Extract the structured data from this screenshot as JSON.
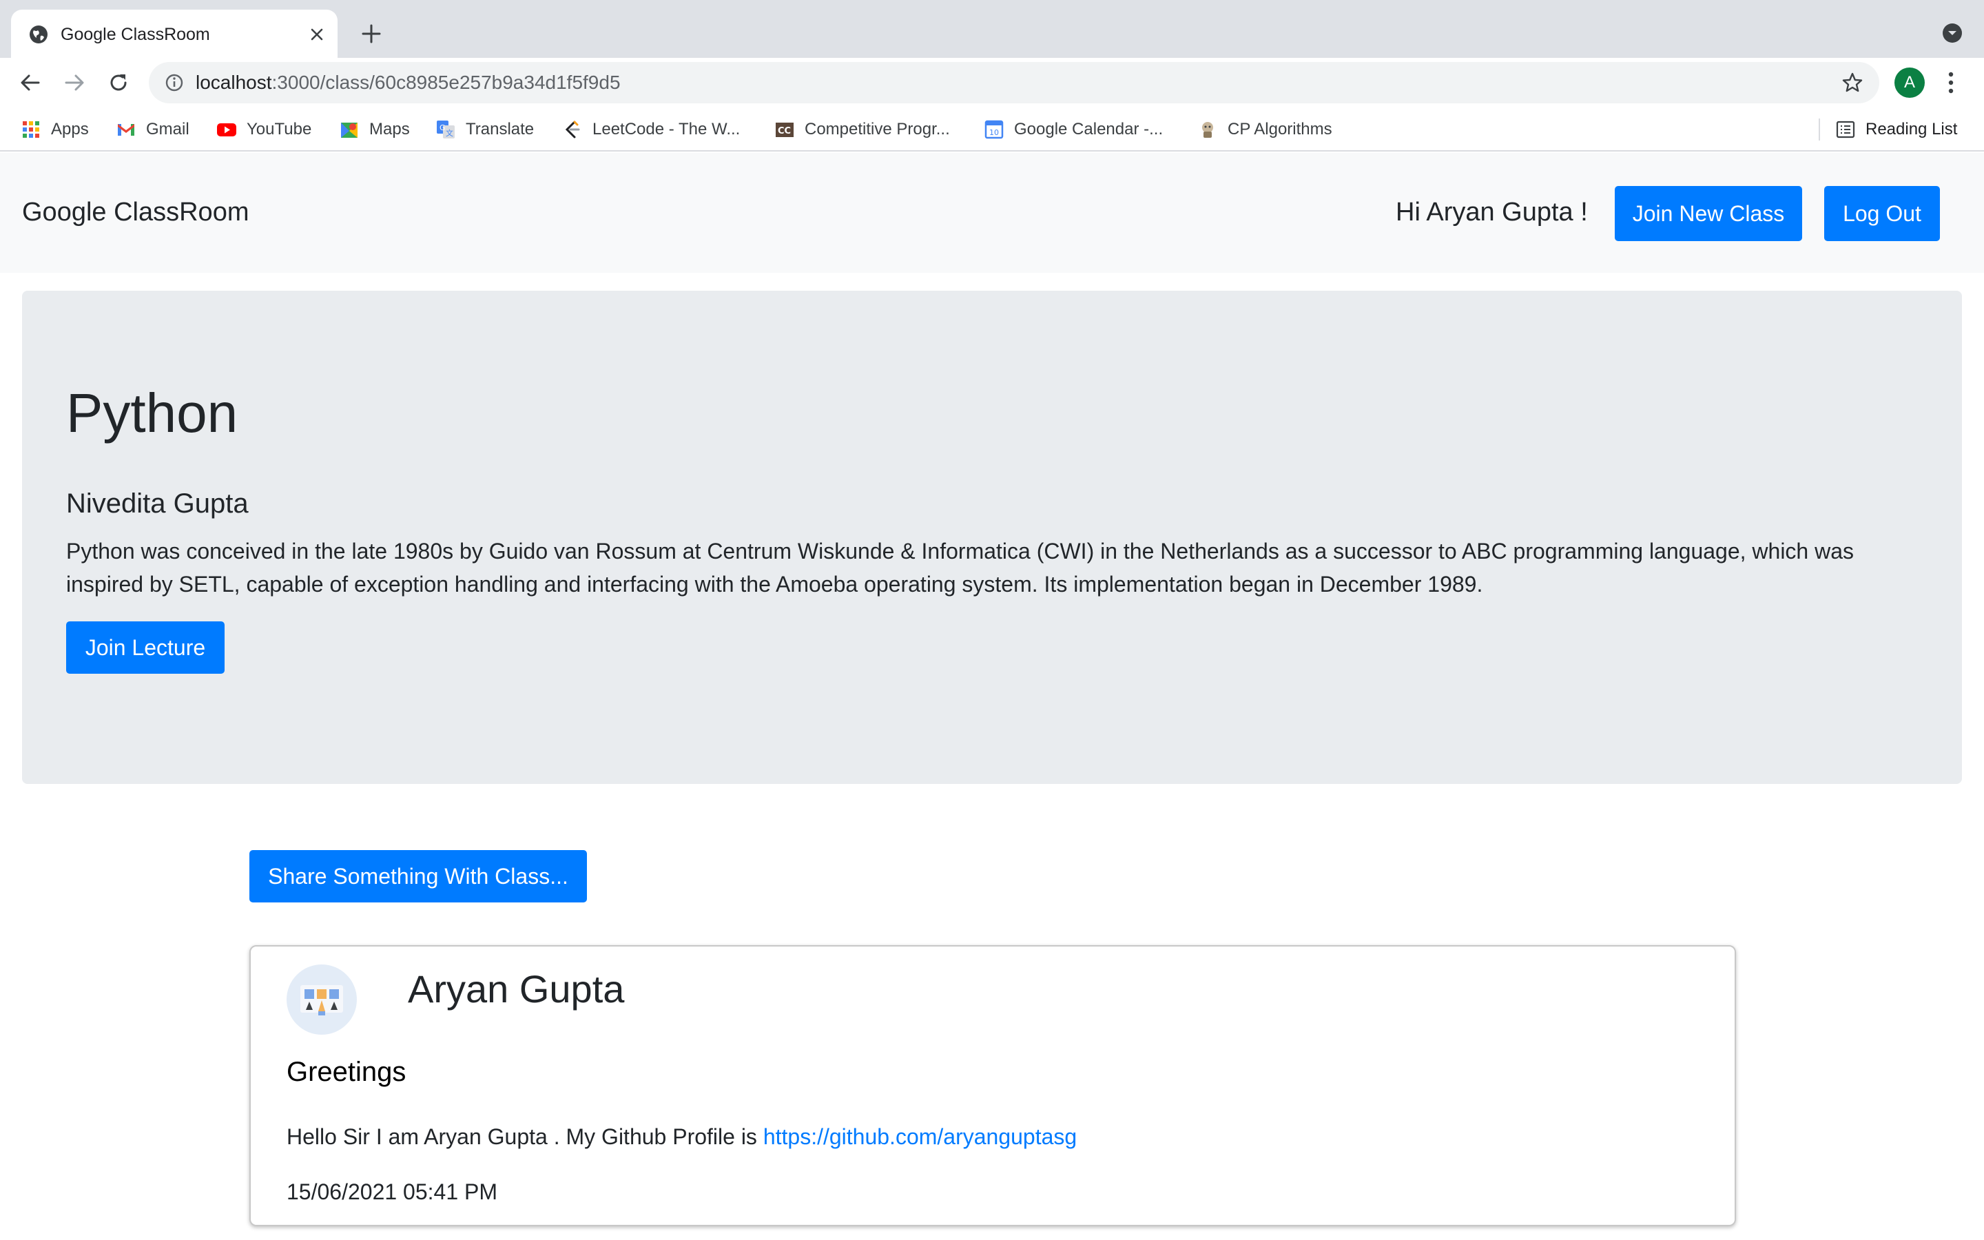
{
  "browser": {
    "tab_title": "Google ClassRoom",
    "url_host": "localhost",
    "url_rest": ":3000/class/60c8985e257b9a34d1f5f9d5",
    "profile_initial": "A",
    "bookmarks": [
      {
        "label": "Apps",
        "icon": "apps-grid-icon"
      },
      {
        "label": "Gmail",
        "icon": "gmail-icon"
      },
      {
        "label": "YouTube",
        "icon": "youtube-icon"
      },
      {
        "label": "Maps",
        "icon": "maps-icon"
      },
      {
        "label": "Translate",
        "icon": "translate-icon"
      },
      {
        "label": "LeetCode - The W...",
        "icon": "leetcode-icon"
      },
      {
        "label": "Competitive Progr...",
        "icon": "codechef-icon"
      },
      {
        "label": "Google Calendar -...",
        "icon": "calendar-icon"
      },
      {
        "label": "CP Algorithms",
        "icon": "cp-algorithms-icon"
      }
    ],
    "reading_list": "Reading List"
  },
  "navbar": {
    "brand": "Google ClassRoom",
    "greeting": "Hi Aryan Gupta !",
    "join_class": "Join New Class",
    "logout": "Log Out"
  },
  "class": {
    "title": "Python",
    "teacher": "Nivedita Gupta",
    "description": "Python was conceived in the late 1980s by Guido van Rossum at Centrum Wiskunde & Informatica (CWI) in the Netherlands as a successor to ABC programming language, which was inspired by SETL, capable of exception handling and interfacing with the Amoeba operating system. Its implementation began in December 1989.",
    "join_lecture": "Join Lecture",
    "share": "Share Something With Class..."
  },
  "post": {
    "author": "Aryan Gupta",
    "title": "Greetings",
    "body_text": "Hello Sir I am Aryan Gupta . My Github Profile is ",
    "link": "https://github.com/aryanguptasg",
    "date": "15/06/2021 05:41 PM"
  },
  "colors": {
    "primary": "#007bff",
    "navbar_bg": "#f8f9fa",
    "jumbotron_bg": "#e9ecef",
    "tabstrip_bg": "#dee1e6"
  }
}
